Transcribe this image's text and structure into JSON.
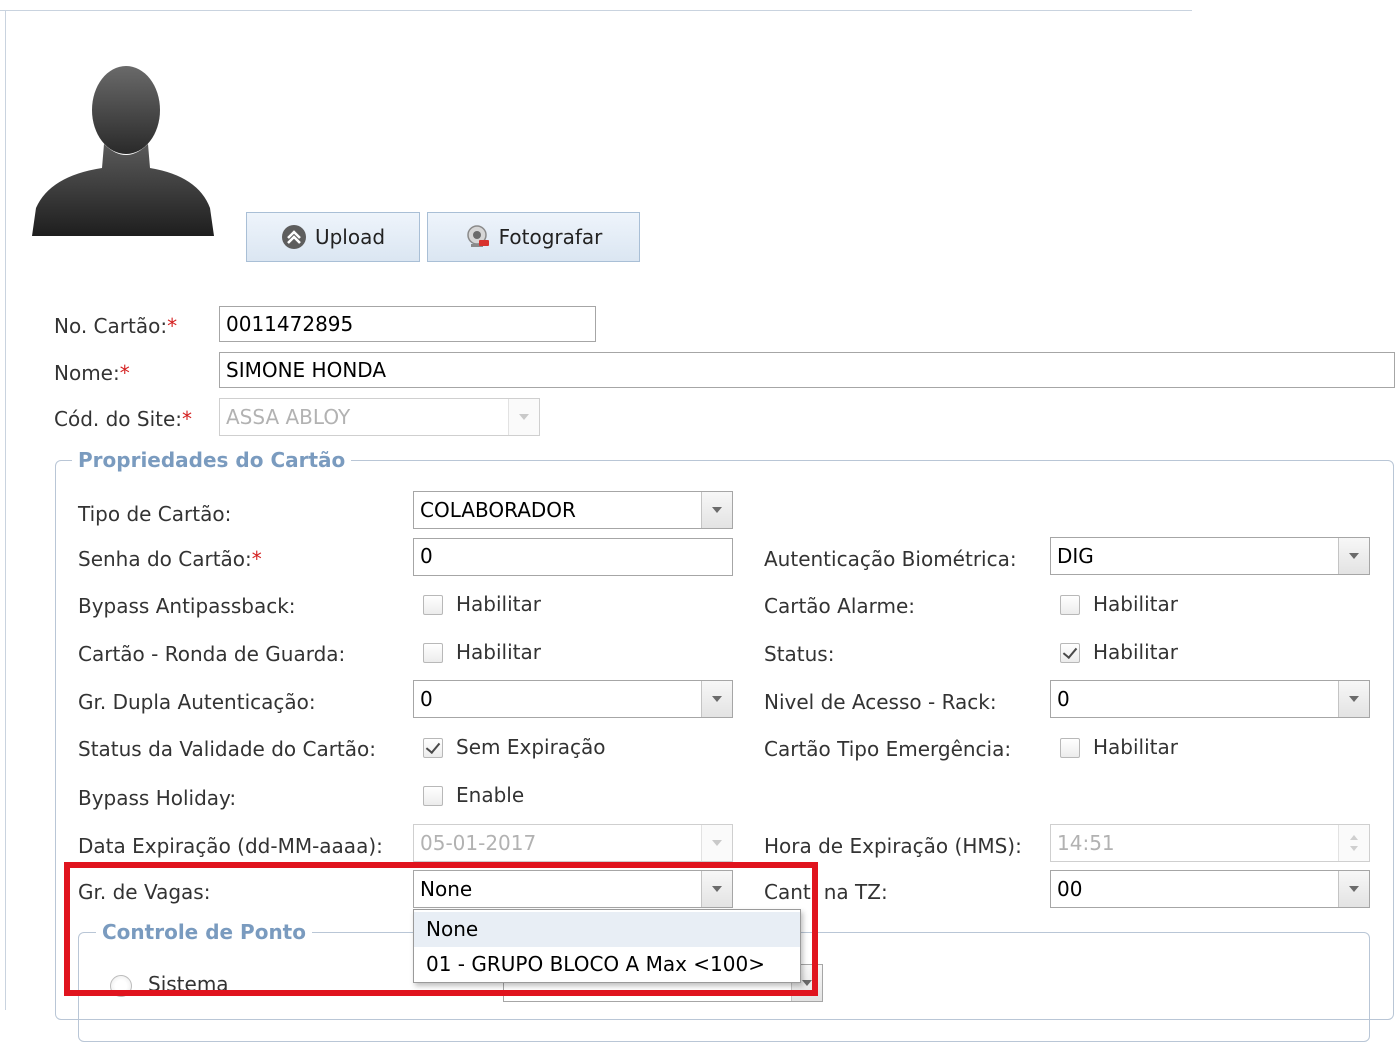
{
  "photo": {
    "upload_label": "Upload",
    "photograph_label": "Fotografar",
    "avatar_icon": "user-silhouette-icon",
    "upload_icon": "upload-arrow-icon",
    "camera_icon": "webcam-icon"
  },
  "card_form": {
    "card_number": {
      "label": "No. Cartão:",
      "required_mark": "*",
      "value": "0011472895"
    },
    "name": {
      "label": "Nome:",
      "required_mark": "*",
      "value": "SIMONE HONDA"
    },
    "site_code": {
      "label": "Cód. do Site:",
      "required_mark": "*",
      "value": "ASSA ABLOY"
    }
  },
  "card_properties": {
    "legend": "Propriedades do Cartão",
    "card_type": {
      "label": "Tipo de Cartão:",
      "value": "COLABORADOR"
    },
    "card_password": {
      "label": "Senha do Cartão:",
      "required_mark": "*",
      "value": "0"
    },
    "biometric_auth": {
      "label": "Autenticação Biométrica:",
      "value": "DIG"
    },
    "bypass_antipassback": {
      "label": "Bypass Antipassback:",
      "checkbox_label": "Habilitar",
      "checked": false
    },
    "alarm_card": {
      "label": "Cartão Alarme:",
      "checkbox_label": "Habilitar",
      "checked": false
    },
    "guard_tour_card": {
      "label": "Cartão - Ronda de Guarda:",
      "checkbox_label": "Habilitar",
      "checked": false
    },
    "status": {
      "label": "Status:",
      "checkbox_label": "Habilitar",
      "checked": true
    },
    "dual_auth_group": {
      "label": "Gr. Dupla Autenticação:",
      "value": "0"
    },
    "rack_access_level": {
      "label": "Nivel de Acesso - Rack:",
      "value": "0"
    },
    "validity_status": {
      "label": "Status da Validade do Cartão:",
      "checkbox_label": "Sem Expiração",
      "checked": true
    },
    "emergency_card": {
      "label": "Cartão Tipo Emergência:",
      "checkbox_label": "Habilitar",
      "checked": false
    },
    "bypass_holiday": {
      "label": "Bypass Holiday:",
      "checkbox_label": "Enable",
      "checked": false
    },
    "expiration_date": {
      "label": "Data Expiração (dd-MM-aaaa):",
      "value": "05-01-2017"
    },
    "expiration_time": {
      "label": "Hora de Expiração (HMS):",
      "value": "14:51"
    },
    "parking_group": {
      "label": "Gr. de Vagas:",
      "value": "None",
      "options": [
        "None",
        "01 - GRUPO BLOCO A Max <100>"
      ]
    },
    "canteen_tz": {
      "label_before": "Cant",
      "label_after": "na TZ:",
      "value": "00"
    },
    "time_control": {
      "legend": "Controle de Ponto",
      "system_radio_label": "Sistema"
    }
  },
  "colors": {
    "highlight_box": "#e0141e",
    "legend_text": "#7a9bbf",
    "required": "#d41f1f"
  }
}
